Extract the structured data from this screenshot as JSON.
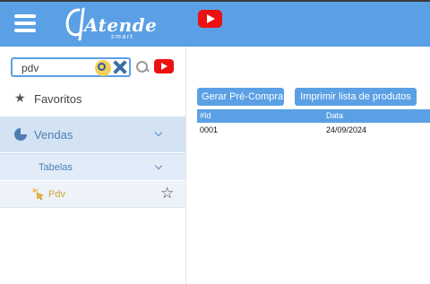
{
  "header": {
    "logo_text": "Atende",
    "logo_subtext": "smart",
    "icons": [
      "menu-icon",
      "youtube-icon"
    ]
  },
  "sidebar": {
    "search": {
      "value": "pdv",
      "placeholder": "",
      "icons": [
        "search-clear-icon",
        "close-icon",
        "search-icon",
        "youtube-icon"
      ]
    },
    "items": [
      {
        "label": "Favoritos",
        "icon": "star-icon"
      },
      {
        "label": "Vendas",
        "icon": "pie-chart-icon",
        "expanded": true
      },
      {
        "label": "Tabelas",
        "expanded": true
      },
      {
        "label": "Pdv",
        "icon": "pointer-click-icon",
        "favorite_icon": "star-outline-icon"
      }
    ]
  },
  "main": {
    "buttons": {
      "pre_compra": "Gerar Pré-Compra",
      "imprimir": "Imprimir lista de produtos"
    },
    "table": {
      "columns": [
        "#Id",
        "Data"
      ],
      "rows": [
        [
          "0001",
          "24/09/2024"
        ]
      ]
    }
  },
  "colors": {
    "primary": "#5ba0e5",
    "selected_bg": "#d3e3f4",
    "submenu_bg": "#e1ecf8",
    "youtube_red": "#ee1111",
    "pdv_label": "#d2a436"
  }
}
